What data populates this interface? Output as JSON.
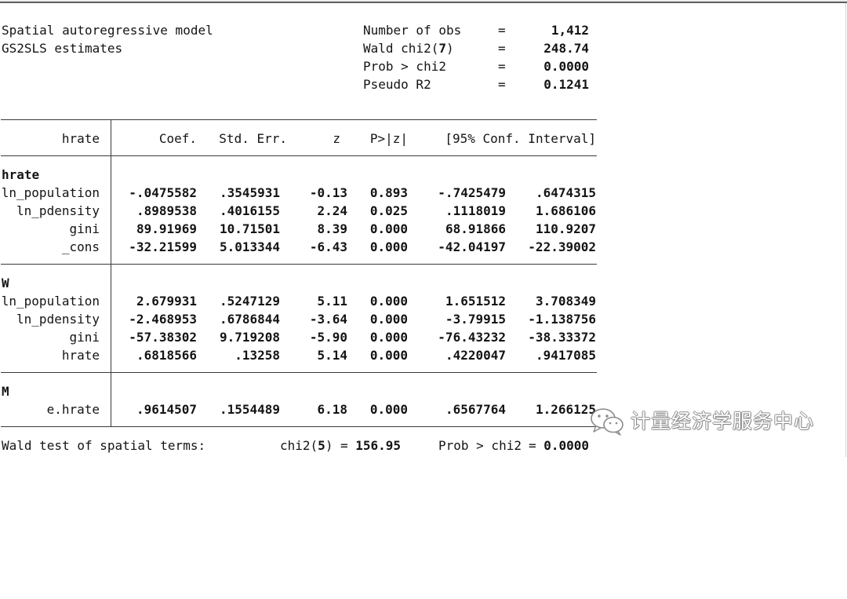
{
  "model": {
    "title": "Spatial autoregressive model",
    "method": "GS2SLS estimates"
  },
  "equals_sign": "=",
  "summary": {
    "obs": {
      "label": "Number of obs",
      "value": "1,412"
    },
    "wald": {
      "label": "Wald chi2(",
      "df": "7",
      "close": ")",
      "value": "248.74"
    },
    "prob": {
      "label": "Prob > chi2",
      "value": "0.0000"
    },
    "pseudo_r2": {
      "label": "Pseudo R2",
      "value": "0.1241"
    }
  },
  "table": {
    "depvar": "hrate",
    "headers": {
      "coef": "Coef.",
      "se": "Std. Err.",
      "z": "z",
      "p": "P>|z|",
      "ci": "[95% Conf. Interval]"
    },
    "equations": [
      {
        "name": "hrate",
        "rows": [
          {
            "var": "ln_population",
            "coef": "-.0475582",
            "se": ".3545931",
            "z": "-0.13",
            "p": "0.893",
            "ci_low": "-.7425479",
            "ci_high": ".6474315"
          },
          {
            "var": "ln_pdensity",
            "coef": ".8989538",
            "se": ".4016155",
            "z": "2.24",
            "p": "0.025",
            "ci_low": ".1118019",
            "ci_high": "1.686106"
          },
          {
            "var": "gini",
            "coef": "89.91969",
            "se": "10.71501",
            "z": "8.39",
            "p": "0.000",
            "ci_low": "68.91866",
            "ci_high": "110.9207"
          },
          {
            "var": "_cons",
            "coef": "-32.21599",
            "se": "5.013344",
            "z": "-6.43",
            "p": "0.000",
            "ci_low": "-42.04197",
            "ci_high": "-22.39002"
          }
        ]
      },
      {
        "name": "W",
        "rows": [
          {
            "var": "ln_population",
            "coef": "2.679931",
            "se": ".5247129",
            "z": "5.11",
            "p": "0.000",
            "ci_low": "1.651512",
            "ci_high": "3.708349"
          },
          {
            "var": "ln_pdensity",
            "coef": "-2.468953",
            "se": ".6786844",
            "z": "-3.64",
            "p": "0.000",
            "ci_low": "-3.79915",
            "ci_high": "-1.138756"
          },
          {
            "var": "gini",
            "coef": "-57.38302",
            "se": "9.719208",
            "z": "-5.90",
            "p": "0.000",
            "ci_low": "-76.43232",
            "ci_high": "-38.33372"
          },
          {
            "var": "hrate",
            "coef": ".6818566",
            "se": ".13258",
            "z": "5.14",
            "p": "0.000",
            "ci_low": ".4220047",
            "ci_high": ".9417085"
          }
        ]
      },
      {
        "name": "M",
        "rows": [
          {
            "var": "e.hrate",
            "coef": ".9614507",
            "se": ".1554489",
            "z": "6.18",
            "p": "0.000",
            "ci_low": ".6567764",
            "ci_high": "1.266125"
          }
        ]
      }
    ]
  },
  "wald_test": {
    "label": "Wald test of spatial terms:",
    "chi2_label": "chi2(",
    "df": "5",
    "chi2_close": ")",
    "chi2": "156.95",
    "prob_label": "Prob > chi2",
    "prob": "0.0000"
  },
  "watermark": {
    "icon": "wechat-logo-icon",
    "text": "计量经济学服务中心"
  }
}
